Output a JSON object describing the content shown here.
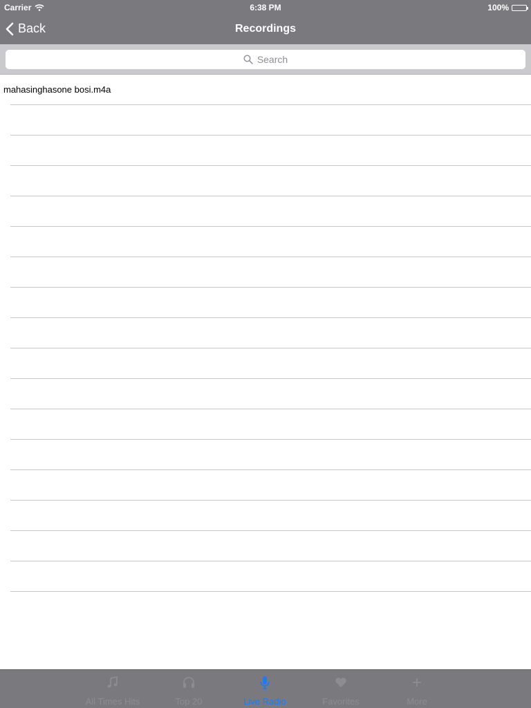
{
  "status_bar": {
    "carrier": "Carrier",
    "time": "6:38 PM",
    "battery": "100%"
  },
  "nav": {
    "back_label": "Back",
    "title": "Recordings"
  },
  "search": {
    "placeholder": "Search"
  },
  "recordings": {
    "items": [
      {
        "label": "mahasinghasone bosi.m4a"
      }
    ]
  },
  "tabs": [
    {
      "label": "All Times Hits",
      "icon": "music-note-icon",
      "active": false
    },
    {
      "label": "Top 20",
      "icon": "headphones-icon",
      "active": false
    },
    {
      "label": "Live Radio",
      "icon": "microphone-icon",
      "active": true
    },
    {
      "label": "Favorites",
      "icon": "heart-icon",
      "active": false
    },
    {
      "label": "More",
      "icon": "plus-icon",
      "active": false
    }
  ],
  "colors": {
    "bar_background": "#7a797e",
    "tab_active": "#1b7cf5",
    "tab_inactive": "#8d8c91",
    "separator": "#c8c7cc"
  }
}
